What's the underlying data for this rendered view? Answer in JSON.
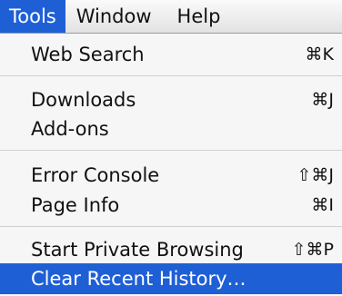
{
  "menubar": {
    "items": [
      {
        "label": "Tools",
        "active": true
      },
      {
        "label": "Window",
        "active": false
      },
      {
        "label": "Help",
        "active": false
      }
    ]
  },
  "menu": {
    "items": [
      {
        "label": "Web Search",
        "shortcut": "⌘K"
      },
      {
        "label": "Downloads",
        "shortcut": "⌘J"
      },
      {
        "label": "Add-ons",
        "shortcut": ""
      },
      {
        "label": "Error Console",
        "shortcut": "⇧⌘J"
      },
      {
        "label": "Page Info",
        "shortcut": "⌘I"
      },
      {
        "label": "Start Private Browsing",
        "shortcut": "⇧⌘P"
      },
      {
        "label": "Clear Recent History…",
        "shortcut": ""
      }
    ],
    "highlighted_item": "Clear Recent History…"
  },
  "colors": {
    "highlight": "#1f5fd6",
    "menu_background": "#f6f6f6"
  }
}
